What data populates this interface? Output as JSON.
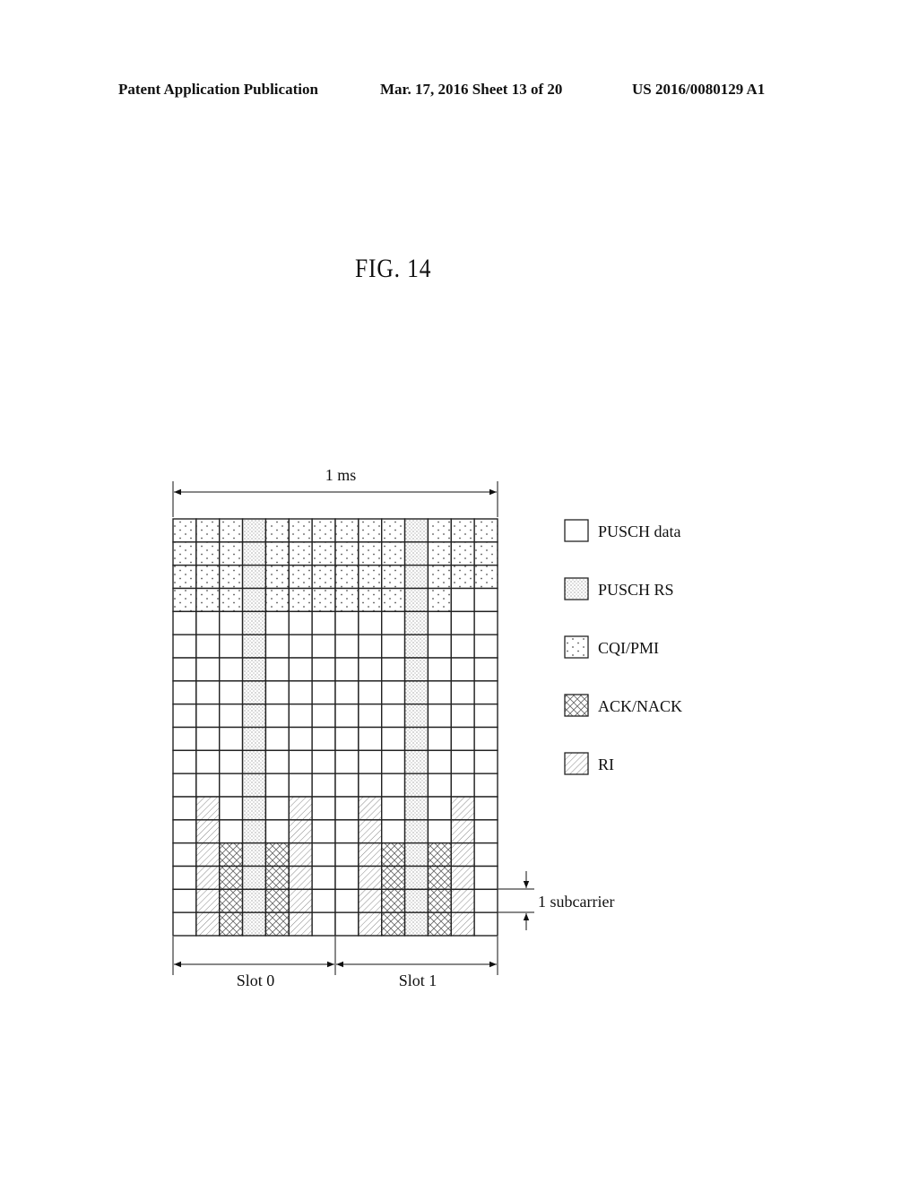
{
  "header": {
    "publication": "Patent Application Publication",
    "date_sheet": "Mar. 17, 2016  Sheet 13 of 20",
    "pub_number": "US 2016/0080129 A1"
  },
  "figure": {
    "title": "FIG. 14",
    "duration_label": "1 ms",
    "slot_labels": [
      "Slot 0",
      "Slot 1"
    ],
    "subcarrier_label": "1 subcarrier",
    "grid": {
      "columns": 14,
      "rows": 18,
      "cells": [
        "CCCRCCCCCCRCCC",
        "CCCRCCCCCCRCCC",
        "CCCRCCCCCCRCCC",
        "CCCRCCCCCCRCDD",
        "DDDRDDDDDDRDDD",
        "DDDRDDDDDDRDDD",
        "DDDRDDDDDDRDDD",
        "DDDRDDDDDDRDDD",
        "DDDRDDDDDDRDDD",
        "DDDRDDDDDDRDDD",
        "DDDRDDDDDDRDDD",
        "DDDRDDDDDDRDDD",
        "DIDRDIDDIDRDID",
        "DIDRDIDDIDRDID",
        "DIARAIDDIARAID",
        "DIARAIDDIARAID",
        "DIARAIDDIARAID",
        "DIARAIDDIARAID"
      ]
    },
    "legend": [
      {
        "code": "D",
        "label": "PUSCH data"
      },
      {
        "code": "R",
        "label": "PUSCH RS"
      },
      {
        "code": "C",
        "label": "CQI/PMI"
      },
      {
        "code": "A",
        "label": "ACK/NACK"
      },
      {
        "code": "I",
        "label": "RI"
      }
    ]
  }
}
